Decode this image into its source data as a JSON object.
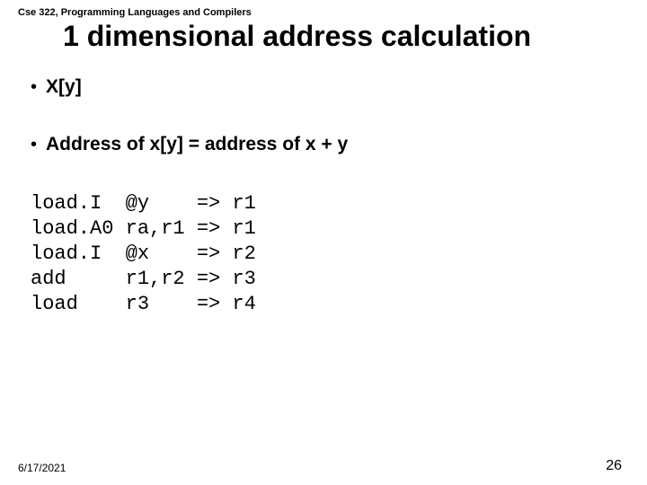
{
  "header": {
    "course": "Cse 322, Programming Languages and Compilers"
  },
  "title": "1 dimensional address calculation",
  "bullets": [
    "X[y]",
    "Address of x[y]  =  address of x  +  y"
  ],
  "code": {
    "rows": [
      {
        "op": "load.I",
        "args": "@y",
        "arrow": "=>",
        "dest": "r1"
      },
      {
        "op": "load.A0",
        "args": "ra,r1",
        "arrow": "=>",
        "dest": "r1"
      },
      {
        "op": "load.I",
        "args": "@x",
        "arrow": "=>",
        "dest": "r2"
      },
      {
        "op": "add",
        "args": "r1,r2",
        "arrow": "=>",
        "dest": "r3"
      },
      {
        "op": "load",
        "args": "r3",
        "arrow": "=>",
        "dest": "r4"
      }
    ]
  },
  "footer": {
    "date": "6/17/2021",
    "page": "26"
  }
}
